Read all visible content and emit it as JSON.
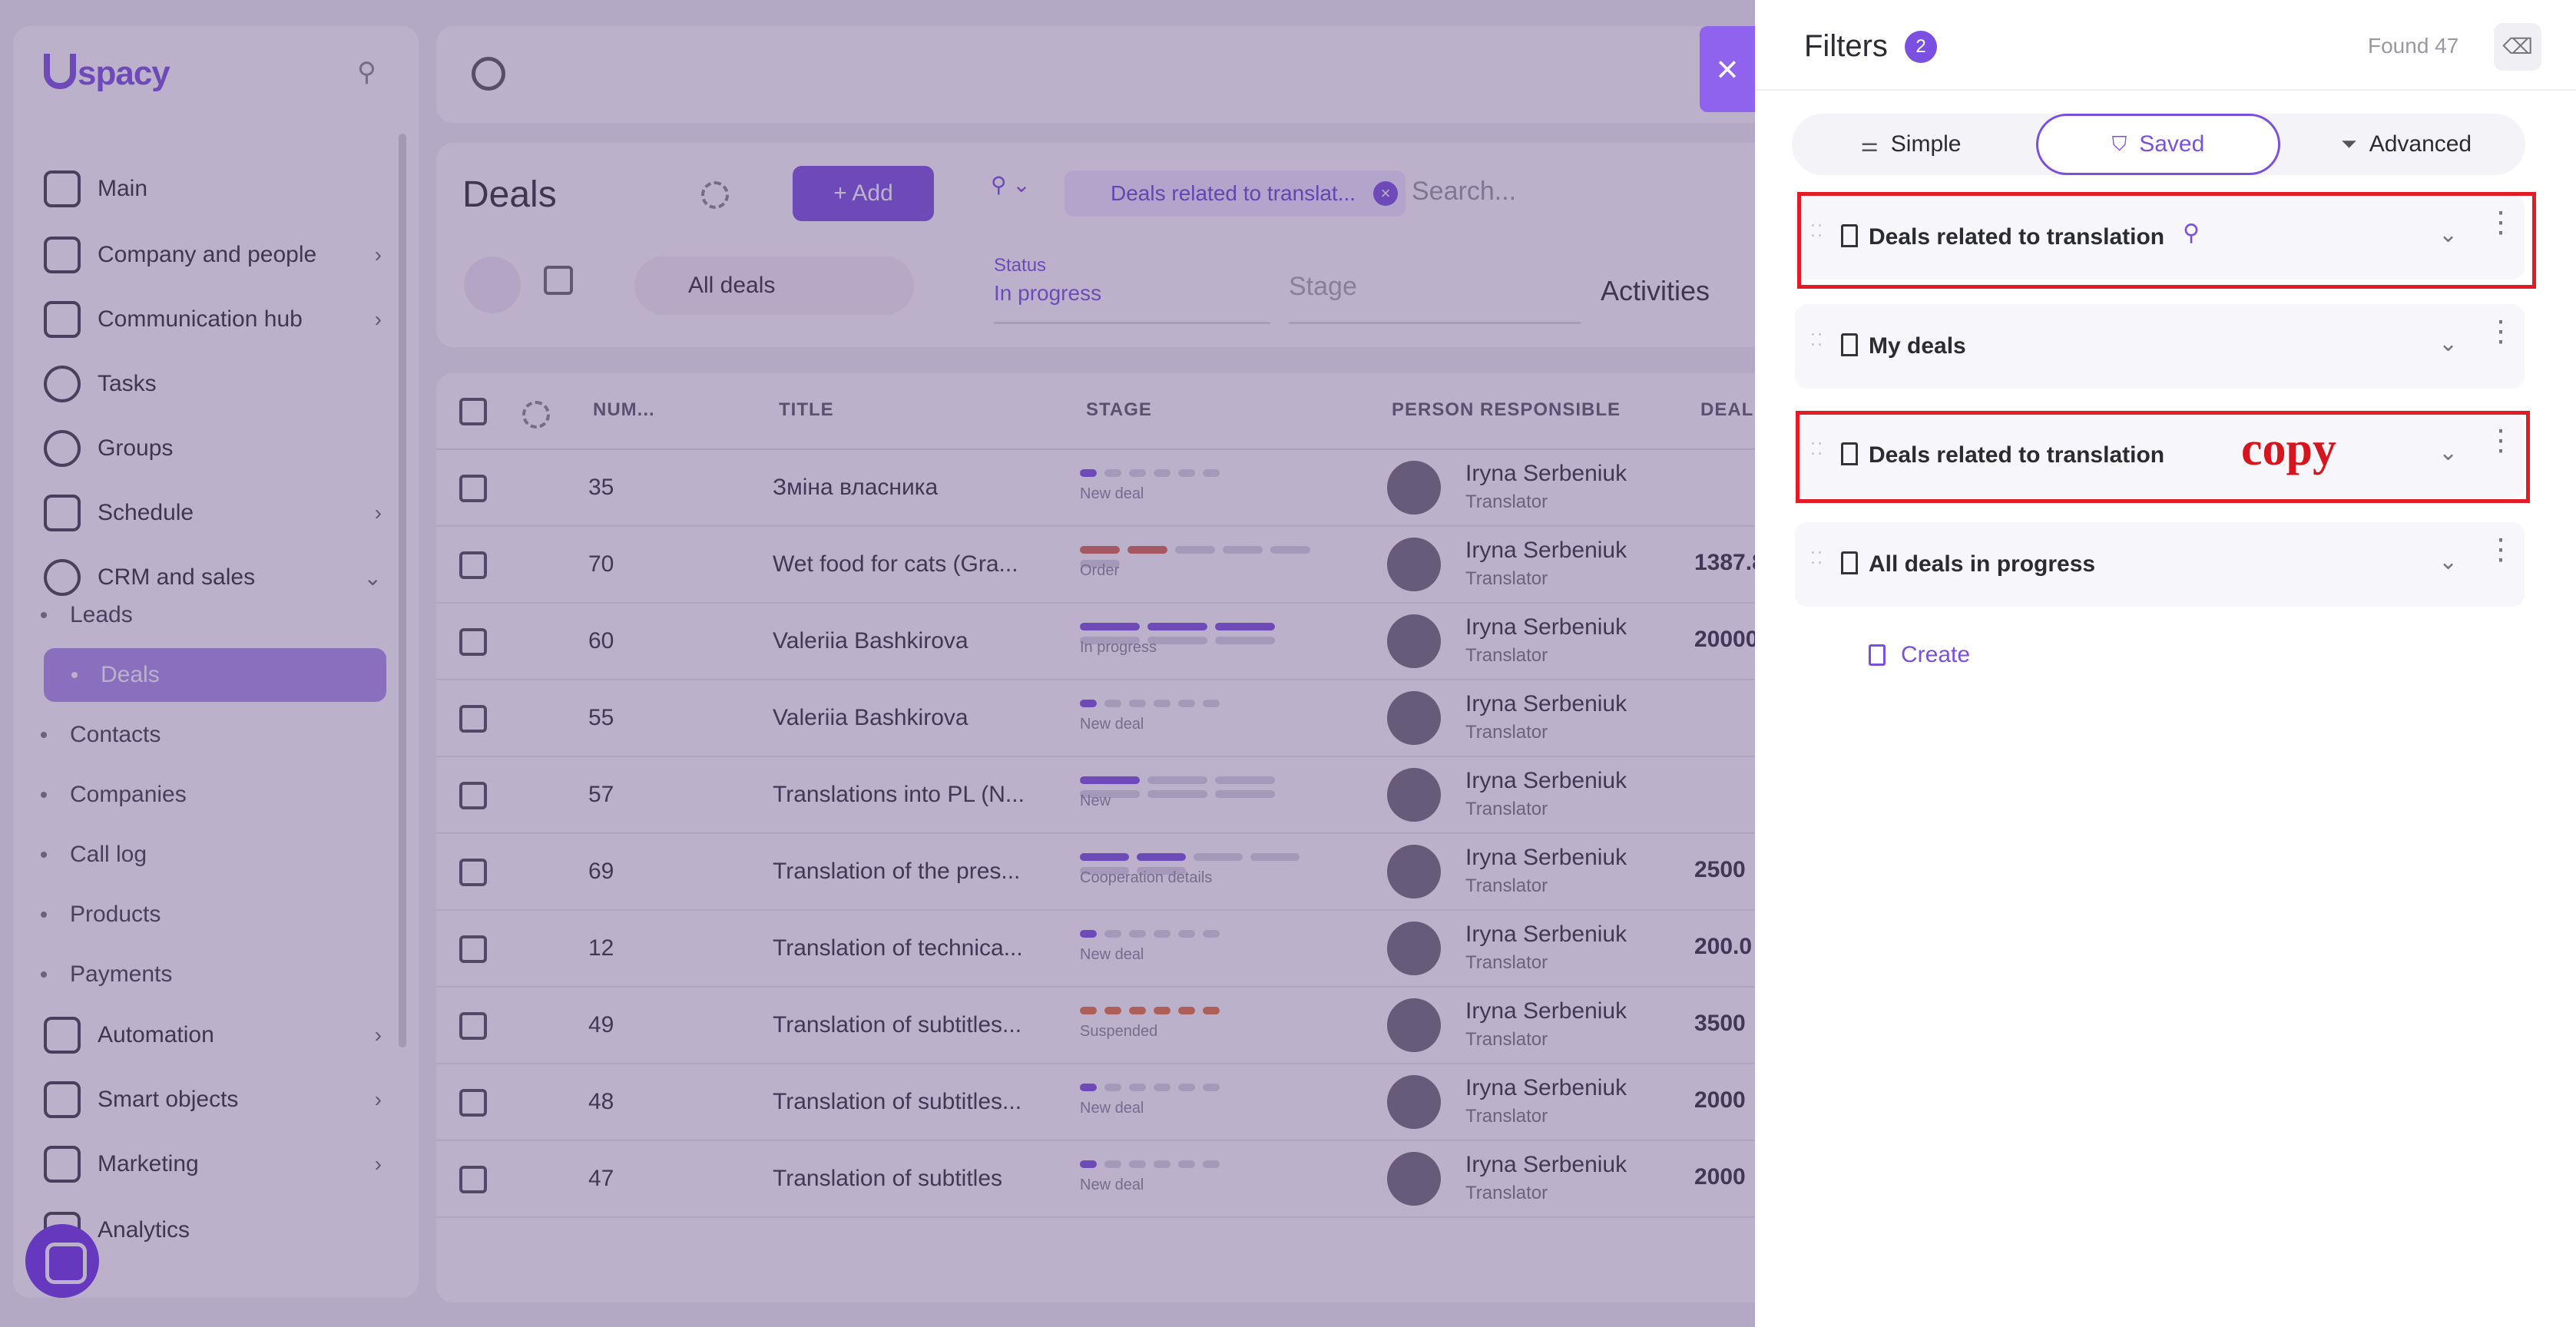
{
  "brand": {
    "logo": "spacy",
    "accent": "#7b4fe0"
  },
  "sidebar": {
    "items": [
      {
        "label": "Main",
        "icon": "home-icon"
      },
      {
        "label": "Company and people",
        "icon": "building-icon"
      },
      {
        "label": "Communication hub",
        "icon": "chat-icon"
      },
      {
        "label": "Tasks",
        "icon": "check-circle-icon"
      },
      {
        "label": "Groups",
        "icon": "people-icon"
      },
      {
        "label": "Schedule",
        "icon": "calendar-icon"
      },
      {
        "label": "CRM and sales",
        "icon": "database-icon"
      }
    ],
    "crm_sub": [
      "Leads",
      "Deals",
      "Contacts",
      "Companies",
      "Call log",
      "Products",
      "Payments"
    ],
    "items_bottom": [
      {
        "label": "Automation",
        "icon": "lightning-icon"
      },
      {
        "label": "Smart objects",
        "icon": "scan-icon"
      },
      {
        "label": "Marketing",
        "icon": "megaphone-icon"
      },
      {
        "label": "Analytics",
        "icon": "chart-icon"
      }
    ]
  },
  "deals": {
    "title": "Deals",
    "add_label": "+ Add",
    "chip_label": "Deals related to translat...",
    "search_placeholder": "Search...",
    "view_select": "All deals",
    "status_label": "Status",
    "status_value": "In progress",
    "stage_placeholder": "Stage",
    "activities_label": "Activities"
  },
  "table": {
    "headers": [
      "NUM...",
      "TITLE",
      "STAGE",
      "PERSON RESPONSIBLE",
      "DEAL"
    ],
    "rows": [
      {
        "num": "35",
        "title": "Зміна власника",
        "stage": "New deal",
        "person": "Iryna Serbeniuk",
        "role": "Translator",
        "amount": ""
      },
      {
        "num": "70",
        "title": "Wet food for cats (Gra...",
        "stage": "Order",
        "person": "Iryna Serbeniuk",
        "role": "Translator",
        "amount": "1387.8"
      },
      {
        "num": "60",
        "title": "Valeriia Bashkirova",
        "stage": "In progress",
        "person": "Iryna Serbeniuk",
        "role": "Translator",
        "amount": "20000"
      },
      {
        "num": "55",
        "title": "Valeriia Bashkirova",
        "stage": "New deal",
        "person": "Iryna Serbeniuk",
        "role": "Translator",
        "amount": ""
      },
      {
        "num": "57",
        "title": "Translations into PL (N...",
        "stage": "New",
        "person": "Iryna Serbeniuk",
        "role": "Translator",
        "amount": ""
      },
      {
        "num": "69",
        "title": "Translation of the pres...",
        "stage": "Cooperation details",
        "person": "Iryna Serbeniuk",
        "role": "Translator",
        "amount": "2500"
      },
      {
        "num": "12",
        "title": "Translation of technica...",
        "stage": "New deal",
        "person": "Iryna Serbeniuk",
        "role": "Translator",
        "amount": "200.0"
      },
      {
        "num": "49",
        "title": "Translation of subtitles...",
        "stage": "Suspended",
        "person": "Iryna Serbeniuk",
        "role": "Translator",
        "amount": "3500"
      },
      {
        "num": "48",
        "title": "Translation of subtitles...",
        "stage": "New deal",
        "person": "Iryna Serbeniuk",
        "role": "Translator",
        "amount": "2000"
      },
      {
        "num": "47",
        "title": "Translation of subtitles",
        "stage": "New deal",
        "person": "Iryna Serbeniuk",
        "role": "Translator",
        "amount": "2000"
      }
    ]
  },
  "panel": {
    "title": "Filters",
    "badge": "2",
    "found": "Found 47",
    "tabs": [
      {
        "label": "Simple",
        "icon": "sliders-icon"
      },
      {
        "label": "Saved",
        "icon": "bookmark-icon"
      },
      {
        "label": "Advanced",
        "icon": "filter-icon"
      }
    ],
    "active_tab": "Saved",
    "saved_filters": [
      {
        "label": "Deals related to translation",
        "pinned": true
      },
      {
        "label": "My deals",
        "pinned": false
      },
      {
        "label": "Deals related to translation",
        "pinned": false
      },
      {
        "label": "All deals in progress",
        "pinned": false
      }
    ],
    "create_label": "Create",
    "annotation": "copy",
    "annotation_color": "#e21b25"
  }
}
